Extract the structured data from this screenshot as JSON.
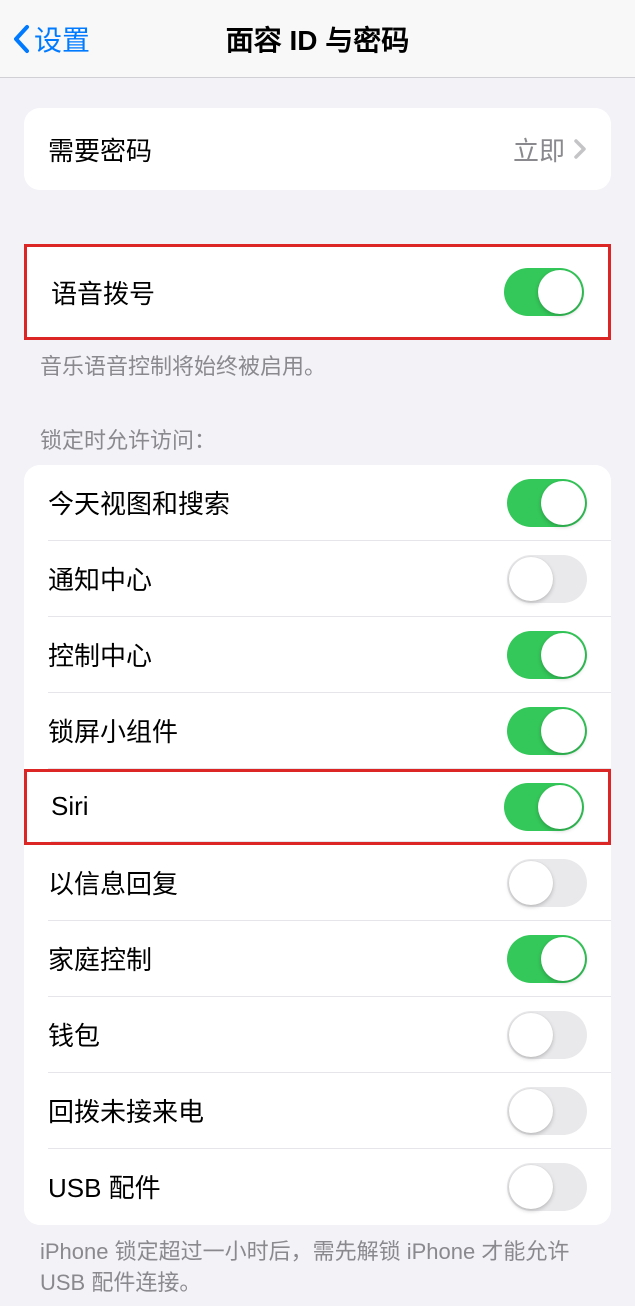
{
  "nav": {
    "back_label": "设置",
    "title": "面容 ID 与密码"
  },
  "require_passcode": {
    "label": "需要密码",
    "value": "立即"
  },
  "voice_dial": {
    "label": "语音拨号",
    "caption": "音乐语音控制将始终被启用。",
    "on": true
  },
  "lock_access": {
    "header": "锁定时允许访问：",
    "items": [
      {
        "label": "今天视图和搜索",
        "on": true
      },
      {
        "label": "通知中心",
        "on": false
      },
      {
        "label": "控制中心",
        "on": true
      },
      {
        "label": "锁屏小组件",
        "on": true
      },
      {
        "label": "Siri",
        "on": true
      },
      {
        "label": "以信息回复",
        "on": false
      },
      {
        "label": "家庭控制",
        "on": true
      },
      {
        "label": "钱包",
        "on": false
      },
      {
        "label": "回拨未接来电",
        "on": false
      },
      {
        "label": "USB 配件",
        "on": false
      }
    ],
    "footer": "iPhone 锁定超过一小时后，需先解锁 iPhone 才能允许 USB 配件连接。"
  }
}
